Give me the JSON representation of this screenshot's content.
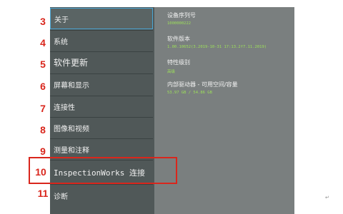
{
  "callouts": [
    "3",
    "4",
    "5",
    "6",
    "7",
    "8",
    "9",
    "10",
    "11"
  ],
  "menu": {
    "items": [
      {
        "label": "关于"
      },
      {
        "label": "系统"
      },
      {
        "label": "软件更新"
      },
      {
        "label": "屏幕和显示"
      },
      {
        "label": "连接性"
      },
      {
        "label": "图像和视频"
      },
      {
        "label": "测量和注释"
      },
      {
        "label": "InspectionWorks 连接"
      },
      {
        "label": "诊断"
      }
    ]
  },
  "details": {
    "serial_label": "设备序列号",
    "serial_value": "1000000222",
    "version_label": "软件版本",
    "version_value": "1.00.10652(3.2019-10-31 17:13.2f7.11.2019)",
    "feature_label": "特性级别",
    "feature_value": "高级",
    "storage_label": "内部驱动器 - 可用空间/容量",
    "storage_value": "53.97 GB / 54.86 GB"
  },
  "corner_mark": "↵",
  "colors": {
    "callout": "#d9261c",
    "sidebar": "#505858",
    "detail_panel": "#7a7f7f",
    "value_text": "#9de05a",
    "active_border": "#4aa6d6"
  }
}
